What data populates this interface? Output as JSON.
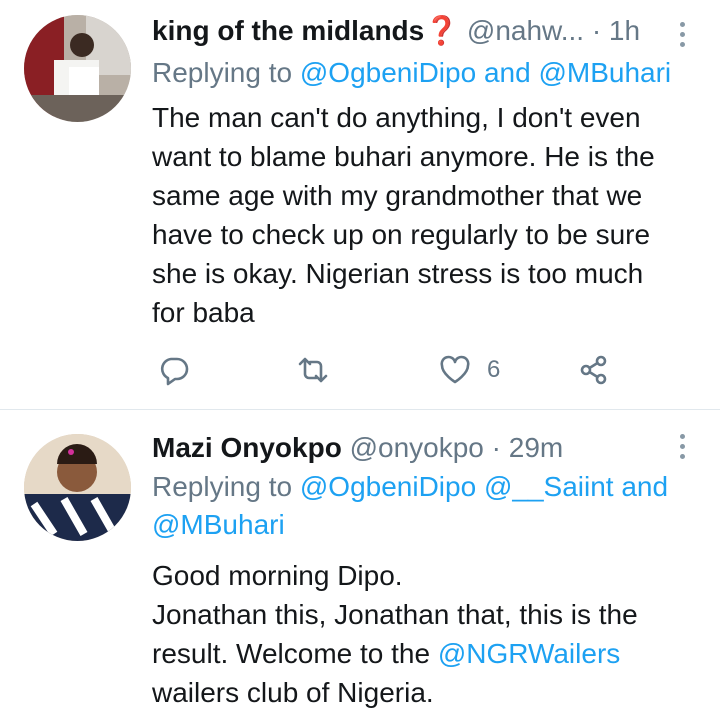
{
  "tweets": [
    {
      "name": "king of the midlands",
      "emoji": "❓",
      "handle": "@nahw...",
      "time": "· 1h",
      "replying_prefix": "Replying to",
      "mentions": [
        "@OgbeniDipo",
        "and",
        "@MBuhari"
      ],
      "body_lines": [
        "The man can't do anything,  I don't even",
        "want to blame buhari anymore. He is the",
        "same age with my grandmother that we",
        "have to check up on regularly to be sure",
        "she is okay. Nigerian stress is too much",
        "for baba"
      ],
      "like_count": "6"
    },
    {
      "name": "Mazi Onyokpo",
      "handle": "@onyokpo",
      "time": "· 29m",
      "replying_prefix": "Replying to",
      "mention1": "@OgbeniDipo",
      "mention2": "@__Saiint",
      "and": "and",
      "mention3": "@MBuhari",
      "body_line1": "Good morning Dipo.",
      "body_line2": "Jonathan this, Jonathan that, this is the",
      "body_line3a": "result. Welcome to the",
      "body_line3_mention": "@NGRWailers",
      "body_line4": "wailers club of Nigeria."
    }
  ],
  "colors": {
    "link": "#1da1f2",
    "secondary_text": "#657786",
    "primary_text": "#14171a",
    "divider": "#e1e8ed"
  },
  "icons": [
    "reply-icon",
    "retweet-icon",
    "like-icon",
    "share-icon",
    "more-options-icon"
  ]
}
